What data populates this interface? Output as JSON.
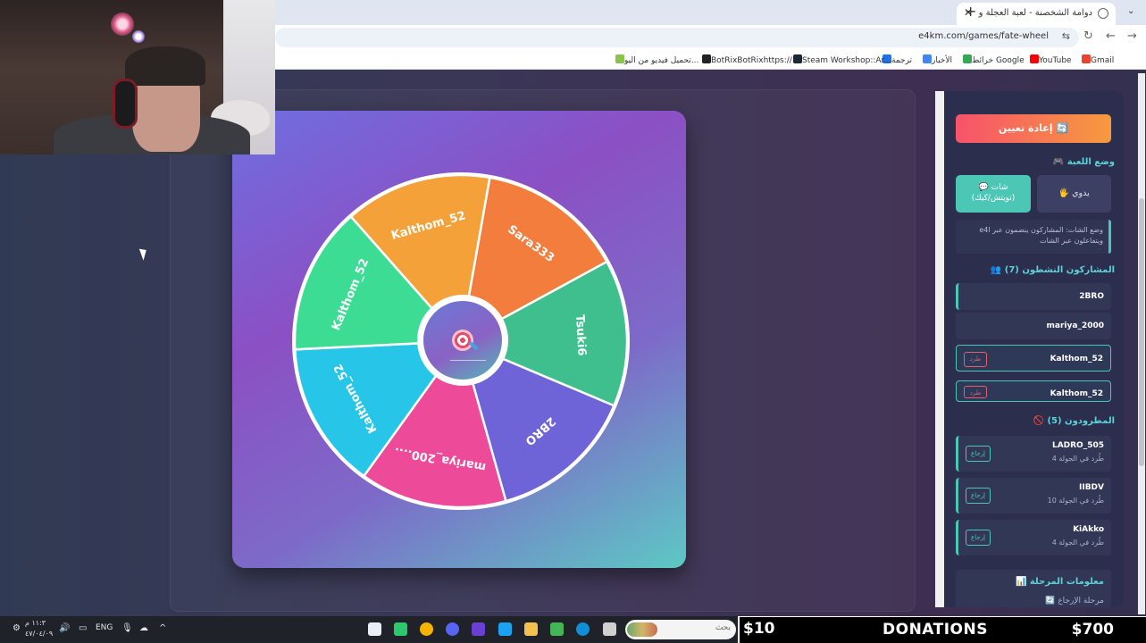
{
  "browser": {
    "tab_title": "دوامة الشخصنة - لعبة العجلة وال",
    "url": "e4km.com/games/fate-wheel",
    "bookmarks": [
      "Gmail",
      "YouTube",
      "خرائط Google",
      "الأخبار",
      "ترجمة",
      "Steam Workshop::Ar...",
      "BotRixBotRixhttps://...",
      "تحميل فيديو من اليو..."
    ]
  },
  "wheel": {
    "segments": [
      {
        "label": "Sara333",
        "color": "#f37d3d"
      },
      {
        "label": "Tsuki6",
        "color": "#3fbf8e"
      },
      {
        "label": "2BRO",
        "color": "#6e64d8"
      },
      {
        "label": "mariya_200....",
        "color": "#ee4a9a"
      },
      {
        "label": "Kalthom_52",
        "color": "#27c6e8"
      },
      {
        "label": "Kalthom_52",
        "color": "#3ddc94"
      },
      {
        "label": "Kalthom_52",
        "color": "#f5a13a"
      }
    ]
  },
  "panel": {
    "reset_label": "إعادة تعيين 🔄",
    "mode_title": "وضع اللعبة 🎮",
    "chat_mode_label_1": "💬 شات",
    "chat_mode_label_2": "(تويتش/كيك)",
    "manual_mode_label": "🖐 يدوي",
    "mode_desc_1": "وضع الشات: المشاركون ينضمون عبر e4l",
    "mode_desc_2": "ويتفاعلون عبر الشات",
    "active_title": "المشاركون النشطون (7) 👥",
    "active": [
      {
        "name": "2BRO"
      },
      {
        "name": "mariya_2000"
      },
      {
        "name": "Kalthom_52",
        "kick": "طرد"
      },
      {
        "name": "Kalthom_52",
        "kick": "طرد"
      }
    ],
    "kicked_title": "المطرودون (5) 🚫",
    "kicked": [
      {
        "name": "LADRO_505",
        "sub": "طُرد في الجولة 4",
        "restore": "إرجاع"
      },
      {
        "name": "IIBDV",
        "sub": "طُرد في الجولة 10",
        "restore": "إرجاع"
      },
      {
        "name": "KiAkko",
        "sub": "طُرد في الجولة 4",
        "restore": "إرجاع"
      }
    ],
    "stage_title": "معلومات المرحلة 📊",
    "stage_line": "مرحلة الإرجاع 🔄"
  },
  "taskbar": {
    "clock_time": "١١:٣ م",
    "clock_date": "٤٧/٠٤/٠٩",
    "lang": "ENG",
    "search_placeholder": "بحث"
  },
  "overlay": {
    "left_amount": "$10",
    "title": "DONATIONS",
    "right_amount": "$700"
  }
}
